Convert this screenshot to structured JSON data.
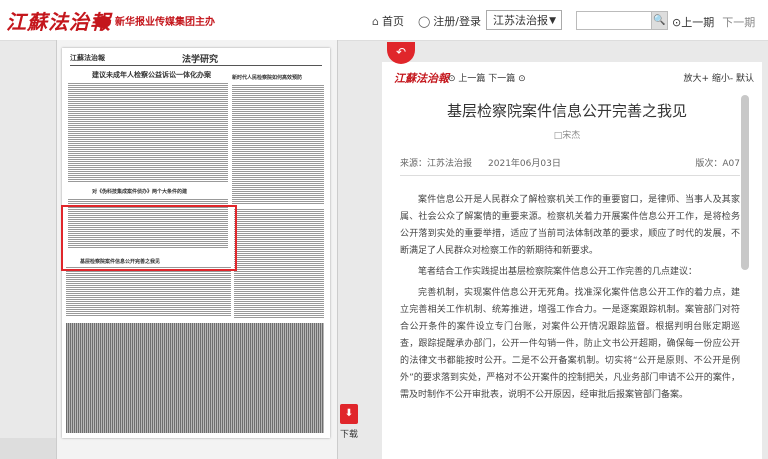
{
  "brand": {
    "logo": "江蘇法治報",
    "group": "新华报业传媒集团主办"
  },
  "nav": {
    "home": "首页",
    "login": "注册/登录",
    "paper_select": "江苏法治报",
    "search_placeholder": "",
    "prev_issue": "上一期",
    "next_issue": "下一期"
  },
  "page_preview": {
    "paper_name": "江蘇法治報",
    "section": "法学研究",
    "headline": "建议未成年人检察公益诉讼一体化办案",
    "box_headline": "基层检察院案件信息公开完善之我见",
    "sub1": "对《伪科技集成案件侦办》两个大条件的建",
    "sub2": "新时代人民检察院如何高效预防",
    "download_label": "下载"
  },
  "article": {
    "toolbar_logo": "江蘇法治報",
    "prev_article": "上一篇",
    "next_article": "下一篇",
    "zoom_in": "放大+",
    "zoom_out": "缩小-",
    "default": "默认",
    "title": "基层检察院案件信息公开完善之我见",
    "author": "□宋杰",
    "source": "来源：江苏法治报",
    "date": "2021年06月03日",
    "edition": "版次：A07",
    "paragraphs": [
      "案件信息公开是人民群众了解检察机关工作的重要窗口，是律师、当事人及其家属、社会公众了解案情的重要来源。检察机关着力开展案件信息公开工作，是将检务公开落到实处的重要举措，适应了当前司法体制改革的要求，顺应了时代的发展，不断满足了人民群众对检察工作的新期待和新要求。",
      "笔者结合工作实践提出基层检察院案件信息公开工作完善的几点建议：",
      "完善机制，实现案件信息公开无死角。找准深化案件信息公开工作的着力点，建立完善相关工作机制、统筹推进，增强工作合力。一是逐案跟踪机制。案管部门对符合公开条件的案件设立专门台账，对案件公开情况跟踪监督。根据判明台账定期巡查，跟踪提醒承办部门，公开一件勾销一件，防止文书公开超期，确保每一份应公开的法律文书都能按时公开。二是不公开备案机制。切实将“公开是原则、不公开是例外”的要求落到实处，严格对不公开案件的控制把关，凡业务部门申请不公开的案件，需及时制作不公开审批表，说明不公开原因，经审批后报案管部门备案。"
    ]
  }
}
